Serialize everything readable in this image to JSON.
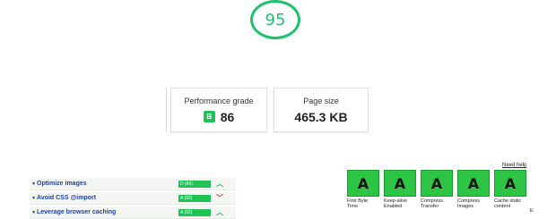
{
  "score": {
    "value": "95",
    "color": "#1ec26c"
  },
  "summary": {
    "performance": {
      "label": "Performance grade",
      "grade": "B",
      "value": "86"
    },
    "page_size": {
      "label": "Page size",
      "value": "465.3 KB"
    }
  },
  "rules": [
    {
      "name": "Optimize images",
      "score": "D (66)",
      "trend": "up"
    },
    {
      "name": "Avoid CSS @import",
      "score": "A (92)",
      "trend": "down"
    },
    {
      "name": "Leverage browser caching",
      "score": "A (92)",
      "trend": "up"
    }
  ],
  "help_link": "Need help",
  "grades": [
    {
      "letter": "A",
      "label": "First Byte Time"
    },
    {
      "letter": "A",
      "label": "Keep-alive Enabled"
    },
    {
      "letter": "A",
      "label": "Compress Transfer"
    },
    {
      "letter": "A",
      "label": "Compress Images"
    },
    {
      "letter": "A",
      "label": "Cache static content"
    }
  ],
  "grade_stub": "E",
  "colors": {
    "green": "#22c155",
    "up_arrow": "#1fa84a",
    "down_arrow": "#d62a2a",
    "link": "#1f3fa8"
  },
  "icons": {
    "caret": "triangle-down",
    "trend_up": "chevron-up",
    "trend_down": "chevron-down"
  }
}
